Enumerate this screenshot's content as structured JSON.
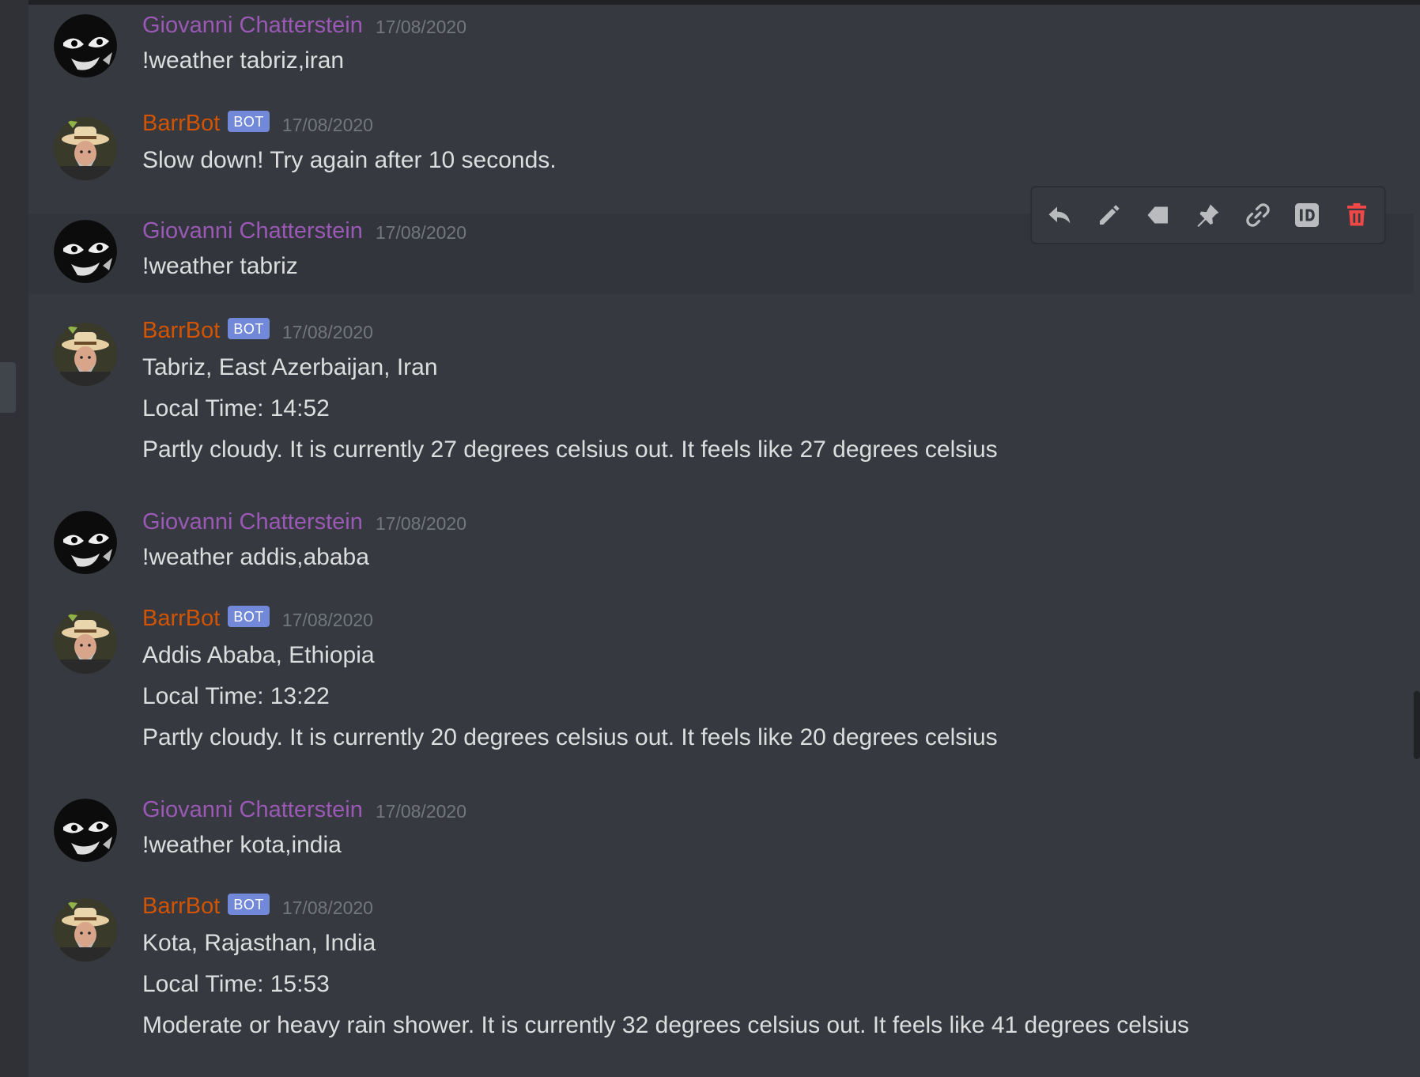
{
  "colors": {
    "background": "#36393f",
    "user_name": "#9b59b6",
    "bot_name": "#d35400",
    "bot_tag": "#7289da",
    "text": "#dcddde",
    "timestamp": "#72767d",
    "delete": "#f04747"
  },
  "toolbar": {
    "icons": [
      "reply-icon",
      "edit-icon",
      "tag-icon",
      "pin-icon",
      "link-icon",
      "id-icon",
      "trash-icon"
    ]
  },
  "messages": [
    {
      "author": "Giovanni Chatterstein",
      "is_bot": false,
      "date": "17/08/2020",
      "lines": [
        "!weather tabriz,iran"
      ]
    },
    {
      "author": "BarrBot",
      "is_bot": true,
      "bot_tag": "BOT",
      "date": "17/08/2020",
      "lines": [
        "Slow down! Try again after 10 seconds."
      ]
    },
    {
      "author": "Giovanni Chatterstein",
      "is_bot": false,
      "date": "17/08/2020",
      "lines": [
        "!weather tabriz"
      ]
    },
    {
      "author": "BarrBot",
      "is_bot": true,
      "bot_tag": "BOT",
      "date": "17/08/2020",
      "lines": [
        "Tabriz, East Azerbaijan, Iran",
        "Local Time: 14:52",
        "Partly cloudy. It is currently 27 degrees celsius out. It feels like 27 degrees celsius"
      ]
    },
    {
      "author": "Giovanni Chatterstein",
      "is_bot": false,
      "date": "17/08/2020",
      "lines": [
        "!weather addis,ababa"
      ]
    },
    {
      "author": "BarrBot",
      "is_bot": true,
      "bot_tag": "BOT",
      "date": "17/08/2020",
      "lines": [
        "Addis Ababa, Ethiopia",
        "Local Time: 13:22",
        "Partly cloudy. It is currently 20 degrees celsius out. It feels like 20 degrees celsius"
      ]
    },
    {
      "author": "Giovanni Chatterstein",
      "is_bot": false,
      "date": "17/08/2020",
      "lines": [
        "!weather kota,india"
      ]
    },
    {
      "author": "BarrBot",
      "is_bot": true,
      "bot_tag": "BOT",
      "date": "17/08/2020",
      "lines": [
        "Kota, Rajasthan, India",
        "Local Time: 15:53",
        "Moderate or heavy rain shower. It is currently 32 degrees celsius out. It feels like 41 degrees celsius"
      ]
    }
  ]
}
